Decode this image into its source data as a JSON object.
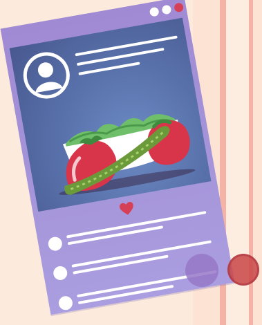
{
  "window": {
    "controls": [
      "dot-white",
      "dot-white",
      "dot-red"
    ]
  },
  "post": {
    "avatar_icon": "user-avatar-icon",
    "image_subject": "salad-illustration",
    "like_icon": "heart-icon",
    "like_color": "#d64056",
    "comment_count": 3
  },
  "colors": {
    "card": "#a797db",
    "photo_bg": "#5a73ad",
    "accent_red": "#d64056",
    "background": "#fcebdc"
  }
}
